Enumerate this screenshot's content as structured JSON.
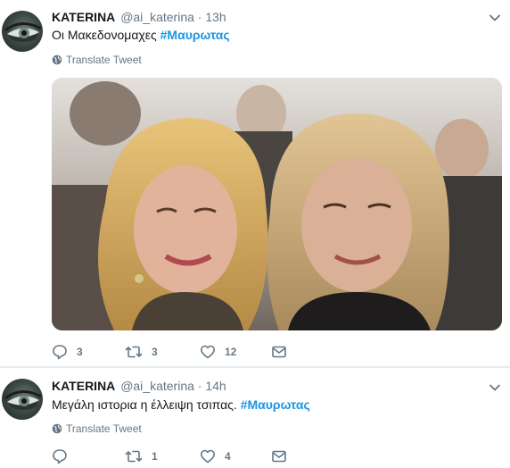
{
  "tweets": [
    {
      "name": "KATERINA",
      "handle": "@ai_katerina",
      "dot": "·",
      "time": "13h",
      "text": "Οι Μακεδονομαχες ",
      "hashtag": "#Μαυρωτας",
      "translate_label": "Translate Tweet",
      "has_media": true,
      "replies": "3",
      "retweets": "3",
      "likes": "12"
    },
    {
      "name": "KATERINA",
      "handle": "@ai_katerina",
      "dot": "·",
      "time": "14h",
      "text": "Μεγάλη ιστορια η έλλειψη τσιπας. ",
      "hashtag": "#Μαυρωτας",
      "translate_label": "Translate Tweet",
      "has_media": false,
      "replies": "",
      "retweets": "1",
      "likes": "4"
    }
  ],
  "icons": {
    "globe": "globe-icon",
    "reply": "reply-icon",
    "retweet": "retweet-icon",
    "like": "heart-icon",
    "dm": "envelope-icon",
    "caret": "chevron-down-icon"
  },
  "colors": {
    "link": "#1b95e0",
    "secondary": "#657786",
    "primary_text": "#14171a",
    "divider": "#e6ecf0"
  }
}
